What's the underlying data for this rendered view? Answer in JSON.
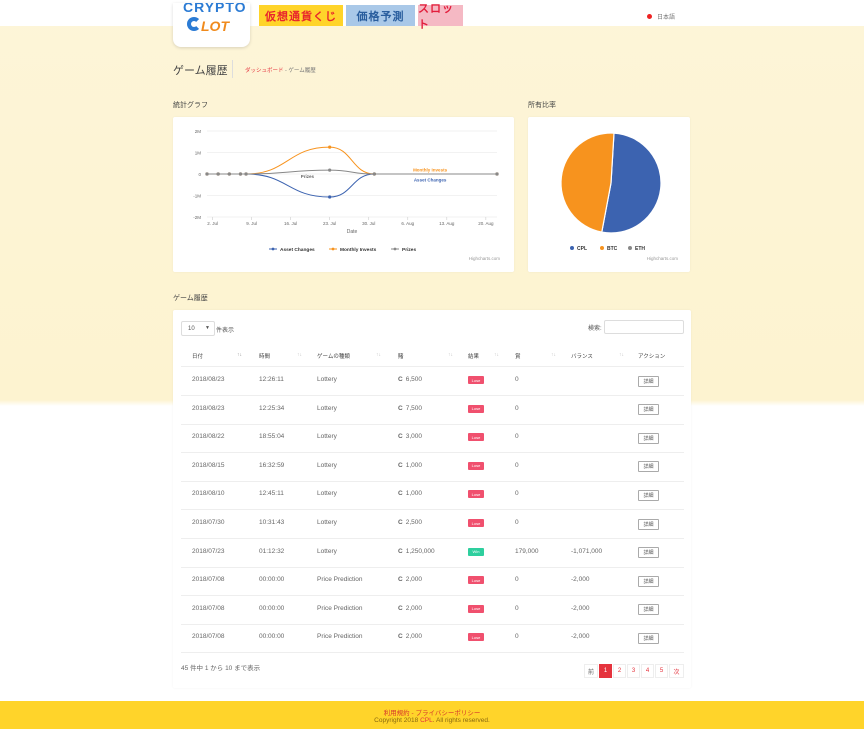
{
  "nav": {
    "logo_top": "CRYPTO",
    "logo_bottom": "LOT",
    "tabs": [
      "仮想通貨くじ",
      "価格予測",
      "スロット"
    ],
    "language": "日本語"
  },
  "page": {
    "title": "ゲーム履歴",
    "breadcrumb_link": "ダッシュボード",
    "breadcrumb_sep": "-",
    "breadcrumb_current": "ゲーム履歴"
  },
  "stats_label": "統計グラフ",
  "share_label": "所有比率",
  "history_label": "ゲーム履歴",
  "chart_data": [
    {
      "type": "line",
      "title": "",
      "xlabel": "Date",
      "ylabel": "",
      "x_ticks": [
        "2. Jul",
        "9. Jul",
        "16. Jul",
        "23. Jul",
        "30. Jul",
        "6. Aug",
        "13. Aug",
        "20. Aug"
      ],
      "y_ticks": [
        "2M",
        "1M",
        "0",
        "-1M",
        "-2M"
      ],
      "ylim": [
        -2000000,
        2000000
      ],
      "x_unit": "days",
      "x_start": "2018-07-01",
      "series": [
        {
          "name": "Asset Changes",
          "color": "#3c63b0",
          "points": [
            [
              0,
              0
            ],
            [
              2,
              0
            ],
            [
              4,
              0
            ],
            [
              6,
              0
            ],
            [
              7,
              0
            ],
            [
              22,
              -1071000
            ],
            [
              30,
              0
            ],
            [
              52,
              0
            ]
          ]
        },
        {
          "name": "Monthly Invests",
          "color": "#f7931e",
          "points": [
            [
              0,
              0
            ],
            [
              2,
              0
            ],
            [
              4,
              0
            ],
            [
              6,
              0
            ],
            [
              7,
              0
            ],
            [
              22,
              1250000
            ],
            [
              30,
              0
            ],
            [
              52,
              0
            ]
          ]
        },
        {
          "name": "Prizes",
          "color": "#888888",
          "points": [
            [
              0,
              0
            ],
            [
              2,
              0
            ],
            [
              4,
              0
            ],
            [
              6,
              0
            ],
            [
              7,
              0
            ],
            [
              22,
              179000
            ],
            [
              30,
              0
            ],
            [
              52,
              0
            ]
          ]
        }
      ],
      "annotations": [
        "Monthly Invests",
        "Asset Changes",
        "Prizes"
      ],
      "legend": "bottom",
      "grid": true
    },
    {
      "type": "pie",
      "labels": [
        "CPL",
        "BTC",
        "ETH"
      ],
      "values": [
        52,
        48,
        0
      ],
      "colors": [
        "#3c63b0",
        "#f7931e",
        "#888888"
      ],
      "legend": "bottom"
    }
  ],
  "credit": "Highcharts.com",
  "table": {
    "length_value": "10",
    "length_label": "件表示",
    "search_label": "検索:",
    "headers": [
      "日付",
      "時間",
      "ゲームの種類",
      "賭",
      "結果",
      "賞",
      "バランス",
      "アクション"
    ],
    "rows": [
      {
        "date": "2018/08/23",
        "time": "12:26:11",
        "game": "Lottery",
        "bet": "6,500",
        "result": "Lose",
        "prize": "0",
        "balance": "",
        "action": "詳細"
      },
      {
        "date": "2018/08/23",
        "time": "12:25:34",
        "game": "Lottery",
        "bet": "7,500",
        "result": "Lose",
        "prize": "0",
        "balance": "",
        "action": "詳細"
      },
      {
        "date": "2018/08/22",
        "time": "18:55:04",
        "game": "Lottery",
        "bet": "3,000",
        "result": "Lose",
        "prize": "0",
        "balance": "",
        "action": "詳細"
      },
      {
        "date": "2018/08/15",
        "time": "16:32:59",
        "game": "Lottery",
        "bet": "1,000",
        "result": "Lose",
        "prize": "0",
        "balance": "",
        "action": "詳細"
      },
      {
        "date": "2018/08/10",
        "time": "12:45:11",
        "game": "Lottery",
        "bet": "1,000",
        "result": "Lose",
        "prize": "0",
        "balance": "",
        "action": "詳細"
      },
      {
        "date": "2018/07/30",
        "time": "10:31:43",
        "game": "Lottery",
        "bet": "2,500",
        "result": "Lose",
        "prize": "0",
        "balance": "",
        "action": "詳細"
      },
      {
        "date": "2018/07/23",
        "time": "01:12:32",
        "game": "Lottery",
        "bet": "1,250,000",
        "result": "Win",
        "prize": "179,000",
        "balance": "-1,071,000",
        "action": "詳細"
      },
      {
        "date": "2018/07/08",
        "time": "00:00:00",
        "game": "Price Prediction",
        "bet": "2,000",
        "result": "Lose",
        "prize": "0",
        "balance": "-2,000",
        "action": "詳細"
      },
      {
        "date": "2018/07/08",
        "time": "00:00:00",
        "game": "Price Prediction",
        "bet": "2,000",
        "result": "Lose",
        "prize": "0",
        "balance": "-2,000",
        "action": "詳細"
      },
      {
        "date": "2018/07/08",
        "time": "00:00:00",
        "game": "Price Prediction",
        "bet": "2,000",
        "result": "Lose",
        "prize": "0",
        "balance": "-2,000",
        "action": "詳細"
      }
    ],
    "currency_symbol": "C",
    "info": "45 件中 1 から 10 まで表示",
    "pager": [
      "前",
      "1",
      "2",
      "3",
      "4",
      "5",
      "次"
    ],
    "active_page": "1"
  },
  "footer": {
    "links": "利用規約 - プライバシーポリシー",
    "copy_pre": "Copyright 2018",
    "copy_brand": "CPL",
    "copy_post": ". All rights reserved."
  }
}
